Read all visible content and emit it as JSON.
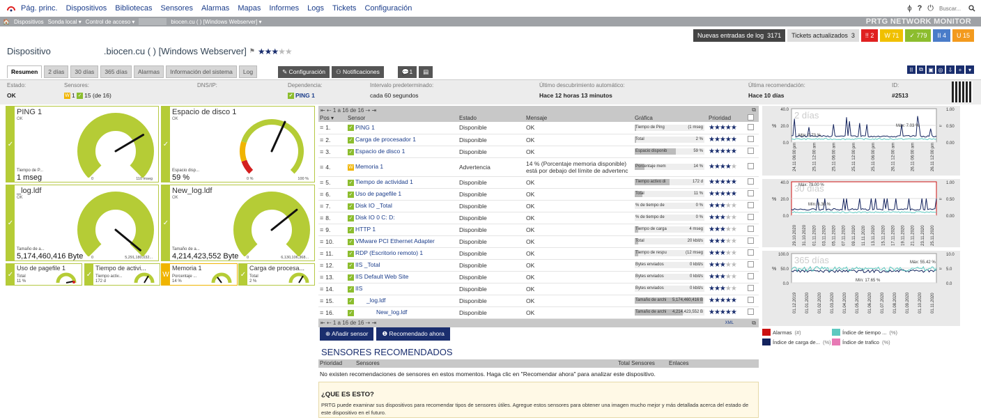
{
  "nav": {
    "items": [
      "Pág. princ.",
      "Dispositivos",
      "Bibliotecas",
      "Sensores",
      "Alarmas",
      "Mapas",
      "Informes",
      "Logs",
      "Tickets",
      "Configuración"
    ],
    "search_placeholder": "Buscar...",
    "icons": [
      "ϕ",
      "?",
      "⏻"
    ]
  },
  "breadcrumb": {
    "items": [
      "🏠",
      "Dispositivos",
      "Sonda local ▾",
      "Control de acceso ▾",
      "",
      "biocen.cu (   ) [Windows Webserver] ▾"
    ],
    "brand": "PRTG NETWORK MONITOR"
  },
  "notifications": {
    "log_label": "Nuevas entradas de log",
    "log_count": "3171",
    "tickets_label": "Tickets actualizados",
    "tickets_count": "3",
    "badges": [
      {
        "text": "!! 2",
        "color": "#e02020"
      },
      {
        "text": "W 71",
        "color": "#f0c000"
      },
      {
        "text": "✓ 779",
        "color": "#8cbd2e"
      },
      {
        "text": "II 4",
        "color": "#4a7cc9"
      },
      {
        "text": "U 15",
        "color": "#f39a1e"
      }
    ]
  },
  "device": {
    "prefix": "Dispositivo",
    "name": ".biocen.cu (       ) [Windows Webserver]",
    "flag": "⚑",
    "stars": "★★★★★"
  },
  "tabs": [
    "Resumen",
    "2 días",
    "30 días",
    "365 días",
    "Alarmas",
    "Información del sistema",
    "Log"
  ],
  "actions": {
    "config": "✎ Configuración",
    "notif": "⚇ Notificaciones",
    "comments": "💬1",
    "history": "▤"
  },
  "toolbar_icons": [
    "II",
    "⧉",
    "▣",
    "◎",
    "⇩",
    "+",
    "▾"
  ],
  "info": {
    "estado_label": "Estado:",
    "estado": "OK",
    "sensores_label": "Sensores:",
    "sensores": "W1 ✓15 (de 16)",
    "dns_label": "DNS/IP:",
    "dns": "",
    "dep_label": "Dependencia:",
    "dep": "PING 1",
    "int_label": "Intervalo predeterminado:",
    "int": "cada 60 segundos",
    "disc_label": "Último descubrimiento automático:",
    "disc": "Hace 12 horas 13 minutos",
    "rec_label": "Última recomendación:",
    "rec": "Hace 10 días",
    "id_label": "ID:",
    "id": "#2513"
  },
  "gauges": [
    {
      "title": "PING 1",
      "status": "OK",
      "label": "Tiempo de P...",
      "value": "1 mseg",
      "min": "0",
      "max": "110 mseg",
      "level": 0.05
    },
    {
      "title": "Espacio de disco 1",
      "status": "OK",
      "label": "Espacio disp...",
      "value": "59 %",
      "min": "0 %",
      "max": "100 %",
      "level": 0.59
    },
    {
      "title": "_log.ldf",
      "status": "OK",
      "label": "Tamaño de a...",
      "value": "5,174,460,416 Byte",
      "min": "0",
      "max": "5,291,180,032...",
      "level": 0.98
    },
    {
      "title": "New_log.ldf",
      "status": "OK",
      "label": "Tamaño de a...",
      "value": "4,214,423,552 Byte",
      "min": "0",
      "max": "6,130,106,368...",
      "level": 0.69
    }
  ],
  "mini_gauges": [
    {
      "title": "Uso de pagefile 1",
      "label": "Total",
      "value": "11 %",
      "warn": false
    },
    {
      "title": "Tiempo de activi...",
      "label": "Tiempo activ...",
      "value": "172 d",
      "warn": false
    },
    {
      "title": "Memoria 1",
      "label": "Porcentaje ...",
      "value": "14 %",
      "warn": true
    },
    {
      "title": "Carga de procesa...",
      "label": "Total",
      "value": "2 %",
      "warn": false
    }
  ],
  "table": {
    "pager": "⇤ ⇠ 1 a 16 de 16 ⇢ ⇥",
    "headers": [
      "Pos ▾",
      "Sensor",
      "Estado",
      "Mensaje",
      "Gráfica",
      "Prioridad",
      ""
    ],
    "rows": [
      {
        "pos": "1.",
        "sensor": "PING 1",
        "estado": "Disponible",
        "msg": "OK",
        "g": "Tiempo de Ping",
        "gv": "(1 mseg",
        "gf": 0.02,
        "stars": 5,
        "st": "ok"
      },
      {
        "pos": "2.",
        "sensor": "Carga de procesador 1",
        "estado": "Disponible",
        "msg": "OK",
        "g": "Total",
        "gv": "2 %",
        "gf": 0.02,
        "stars": 5,
        "st": "ok"
      },
      {
        "pos": "3.",
        "sensor": "Espacio de disco 1",
        "estado": "Disponible",
        "msg": "OK",
        "g": "Espacio disponib",
        "gv": "59 %",
        "gf": 0.59,
        "stars": 5,
        "st": "ok"
      },
      {
        "pos": "4.",
        "sensor": "Memoria 1",
        "estado": "Advertencia",
        "msg": "14 % (Porcentaje memoria disponible)",
        "msg2": "está por debajo del límite de advertenc",
        "g": "Porcentaje mem",
        "gv": "14 %",
        "gf": 0.14,
        "stars": 4,
        "st": "warn"
      },
      {
        "pos": "5.",
        "sensor": "Tiempo de actividad 1",
        "estado": "Disponible",
        "msg": "OK",
        "g": "Tiempo activo di",
        "gv": "172 d",
        "gf": 0.5,
        "stars": 5,
        "st": "ok"
      },
      {
        "pos": "6.",
        "sensor": "Uso de pagefile 1",
        "estado": "Disponible",
        "msg": "OK",
        "g": "Total",
        "gv": "11 %",
        "gf": 0.11,
        "stars": 5,
        "st": "ok"
      },
      {
        "pos": "7.",
        "sensor": "Disk IO _Total",
        "estado": "Disponible",
        "msg": "OK",
        "g": "% de tiempo de",
        "gv": "0 %",
        "gf": 0,
        "stars": 3,
        "st": "ok"
      },
      {
        "pos": "8.",
        "sensor": "Disk IO 0 C: D:",
        "estado": "Disponible",
        "msg": "OK",
        "g": "% de tiempo de",
        "gv": "0 %",
        "gf": 0,
        "stars": 3,
        "st": "ok"
      },
      {
        "pos": "9.",
        "sensor": "HTTP 1",
        "estado": "Disponible",
        "msg": "OK",
        "g": "Tiempo de carga",
        "gv": "4 mseg",
        "gf": 0.05,
        "stars": 3,
        "st": "ok"
      },
      {
        "pos": "10.",
        "sensor": "VMware PCI Ethernet Adapter",
        "estado": "Disponible",
        "msg": "OK",
        "g": "Total",
        "gv": "20 kbit/s",
        "gf": 0.05,
        "stars": 3,
        "st": "ok"
      },
      {
        "pos": "11.",
        "sensor": "RDP (Escritorio remoto) 1",
        "estado": "Disponible",
        "msg": "OK",
        "g": "Tiempo de respu",
        "gv": "(12 mseg",
        "gf": 0.05,
        "stars": 3,
        "st": "ok"
      },
      {
        "pos": "12.",
        "sensor": "IIS _Total",
        "estado": "Disponible",
        "msg": "OK",
        "g": "Bytes enviados",
        "gv": "0 kbit/s",
        "gf": 0,
        "stars": 3,
        "st": "ok"
      },
      {
        "pos": "13.",
        "sensor": "IIS Default Web Site",
        "estado": "Disponible",
        "msg": "OK",
        "g": "Bytes enviados",
        "gv": "0 kbit/s",
        "gf": 0,
        "stars": 3,
        "st": "ok"
      },
      {
        "pos": "14.",
        "sensor": "IIS",
        "estado": "Disponible",
        "msg": "OK",
        "g": "Bytes enviados",
        "gv": "0 kbit/s",
        "gf": 0,
        "stars": 3,
        "st": "ok"
      },
      {
        "pos": "15.",
        "sensor": "_log.ldf",
        "estado": "Disponible",
        "msg": "OK",
        "g": "Tamaño de archi",
        "gv": "5,174,460,416 B",
        "gf": 0.98,
        "stars": 5,
        "st": "ok"
      },
      {
        "pos": "16.",
        "sensor": "New_log.ldf",
        "estado": "Disponible",
        "msg": "OK",
        "g": "Tamaño de archi",
        "gv": "4,214,423,552 B",
        "gf": 0.69,
        "stars": 5,
        "st": "ok"
      }
    ],
    "xml": "XML"
  },
  "add": {
    "sensor": "⊕ Añadir sensor",
    "recommend": "❶ Recomendado ahora"
  },
  "rec": {
    "title": "SENSORES RECOMENDADOS",
    "cols": [
      "Prioridad",
      "Sensores",
      "Total Sensores",
      "Enlaces"
    ],
    "msg": "No existen recomendaciones de sensores en estos momentos. Haga clic en \"Recomendar ahora\" para analizar este dispositivo.",
    "box_title": "¿QUE ES ESTO?",
    "box_text": "PRTG puede examinar sus dispositivos para recomendar tipos de sensores útiles. Agregue estos sensores para obtener una imagen mucho mejor y más detallada acerca del estado de este dispositivo en el futuro."
  },
  "charts": [
    {
      "title": "2 días",
      "yleft": [
        "40.0",
        "20.0",
        "0.0"
      ],
      "yright": [
        "1.00",
        "0.50",
        "0.00"
      ],
      "unit_l": "%",
      "unit_r": "≈",
      "max": "Máx: 7.03 %",
      "min": "Mín: 0.73 %",
      "x": [
        "24.11 06:00 pm",
        "25.11 12:00 am",
        "25.11 06:00 am",
        "25.11 12:00 pm",
        "25.11 06:00 pm",
        "26.11 12:00 am",
        "26.11 06:00 am",
        "26.11 12:00 pm"
      ]
    },
    {
      "title": "30 días",
      "yleft": [
        "40.0",
        "20.0",
        "0.0"
      ],
      "yright": [
        "1.00",
        "0.50",
        "0.00"
      ],
      "unit_l": "%",
      "unit_r": "≈",
      "max": "Máx: 79.00 %",
      "min": "Mín: 6.30 %",
      "x": [
        "29.10.2020",
        "31.10.2020",
        "01.11.2020",
        "03.11.2020",
        "05.11.2020",
        "07.11.2020",
        "09.11.2020",
        "11.11.2020",
        "13.11.2020",
        "15.11.2020",
        "17.11.2020",
        "19.11.2020",
        "21.11.2020",
        "23.11.2020",
        "25.11.2020"
      ]
    },
    {
      "title": "365 días",
      "yleft": [
        "100.0",
        "50.0",
        "0.0"
      ],
      "yright": [
        "10.0",
        "5.0",
        "0.0"
      ],
      "unit_l": "%",
      "unit_r": "≈",
      "max": "Máx: 55.42 %",
      "min": "Mín: 17.65 %",
      "x": [
        "01.12.2019",
        "01.01.2020",
        "01.02.2020",
        "01.03.2020",
        "01.04.2020",
        "01.05.2020",
        "01.06.2020",
        "01.07.2020",
        "01.08.2020",
        "01.09.2020",
        "01.10.2020",
        "01.11.2020"
      ]
    }
  ],
  "legend": [
    {
      "label": "Alarmas",
      "unit": "(#)",
      "color": "#cc1111"
    },
    {
      "label": "Índice de tiempo ...",
      "unit": "(%)",
      "color": "#5dc9c0"
    },
    {
      "label": "Índice de carga de...",
      "unit": "(%)",
      "color": "#13235e"
    },
    {
      "label": "Índice de trafico",
      "unit": "(%)",
      "color": "#e77ab5"
    }
  ]
}
